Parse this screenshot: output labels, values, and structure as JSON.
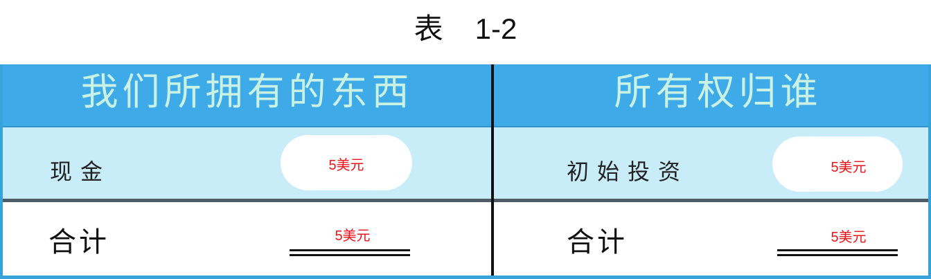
{
  "title": {
    "label": "表",
    "number": "1-2"
  },
  "table": {
    "columns": [
      {
        "header": "我们所拥有的东西",
        "entry": {
          "label": "现金",
          "value": "5美元"
        },
        "total": {
          "label": "合计",
          "value": "5美元"
        }
      },
      {
        "header": "所有权归谁",
        "entry": {
          "label": "初始投资",
          "value": "5美元"
        },
        "total": {
          "label": "合计",
          "value": "5美元"
        }
      }
    ]
  },
  "colors": {
    "header_bg": "#3eaae8",
    "header_text": "#c9f1e4",
    "entry_row_bg": "#c9edf8",
    "value_text": "#e8141a",
    "table_border": "#36a4da"
  }
}
